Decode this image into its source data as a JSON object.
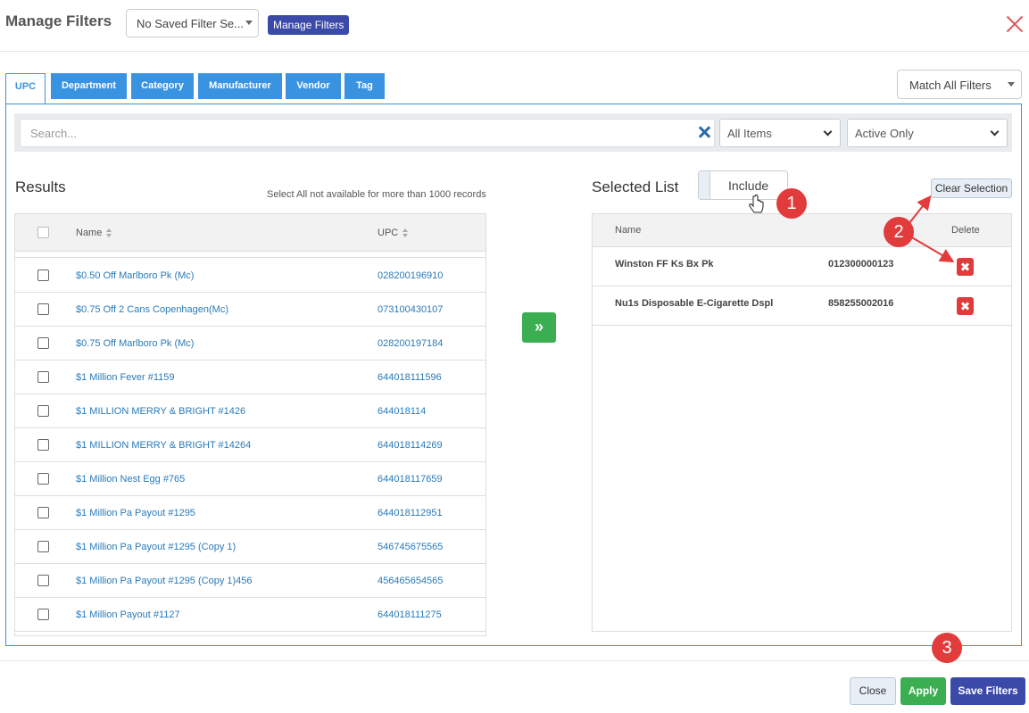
{
  "header": {
    "title": "Manage Filters",
    "saved_filter_select": "No Saved Filter Se...",
    "manage_button": "Manage Filters",
    "close_icon": "close-icon"
  },
  "tabs": [
    {
      "label": "UPC",
      "active": true
    },
    {
      "label": "Department"
    },
    {
      "label": "Category"
    },
    {
      "label": "Manufacturer"
    },
    {
      "label": "Vendor"
    },
    {
      "label": "Tag"
    }
  ],
  "match_select": "Match All Filters",
  "search": {
    "placeholder": "Search...",
    "items_select": "All Items",
    "status_select": "Active Only"
  },
  "results": {
    "title": "Results",
    "note": "Select All not available for more than 1000 records",
    "columns": {
      "name": "Name",
      "upc": "UPC"
    },
    "rows": [
      {
        "name": "$0.50 Off Marlboro Pk (Mc)",
        "upc": "028200196910"
      },
      {
        "name": "$0.75 Off 2 Cans Copenhagen(Mc)",
        "upc": "073100430107"
      },
      {
        "name": "$0.75 Off Marlboro Pk (Mc)",
        "upc": "028200197184"
      },
      {
        "name": "$1 Million Fever #1159",
        "upc": "644018111596"
      },
      {
        "name": "$1 MILLION MERRY & BRIGHT #1426",
        "upc": "644018114"
      },
      {
        "name": "$1 MILLION MERRY & BRIGHT #14264",
        "upc": "644018114269"
      },
      {
        "name": "$1 Million Nest Egg #765",
        "upc": "644018117659"
      },
      {
        "name": "$1 Million Pa Payout #1295",
        "upc": "644018112951"
      },
      {
        "name": "$1 Million Pa Payout #1295 (Copy 1)",
        "upc": "546745675565"
      },
      {
        "name": "$1 Million Pa Payout #1295 (Copy 1)456",
        "upc": "456465654565"
      },
      {
        "name": "$1 Million Payout #1127",
        "upc": "644018111275"
      }
    ]
  },
  "move_button": "»",
  "selected": {
    "title": "Selected List",
    "toggle_label": "Include",
    "clear_button": "Clear Selection",
    "columns": {
      "name": "Name",
      "delete": "Delete"
    },
    "rows": [
      {
        "name": "Winston FF Ks Bx Pk",
        "upc": "012300000123"
      },
      {
        "name": "Nu1s Disposable E-Cigarette Dspl",
        "upc": "858255002016"
      }
    ]
  },
  "footer": {
    "close": "Close",
    "apply": "Apply",
    "save": "Save Filters"
  },
  "annotations": [
    "1",
    "2",
    "3"
  ],
  "colors": {
    "tab_blue": "#3a93e0",
    "primary": "#3b4aa8",
    "success": "#3cae52",
    "danger": "#e03a3a",
    "annotation": "#e23b3b"
  }
}
